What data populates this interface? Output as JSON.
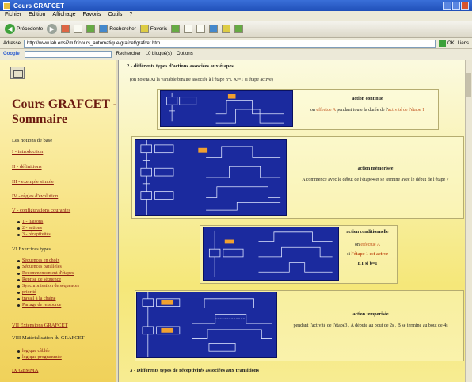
{
  "window": {
    "title": "Cours GRAFCET"
  },
  "menu": [
    "Fichier",
    "Edition",
    "Affichage",
    "Favoris",
    "Outils",
    "?"
  ],
  "toolbar": {
    "back": "Précédente",
    "search": "Rechercher",
    "favorites": "Favoris"
  },
  "address": {
    "label": "Adresse",
    "url": "http://www.lab.ensi2m.fr/cours_automatique/grafcet/grafcet.htm",
    "go": "OK",
    "links": "Liens"
  },
  "googlebar": {
    "logo": "Google",
    "search": "Rechercher",
    "blocked": "10 bloqué(s)",
    "options": "Options"
  },
  "sidebar": {
    "title": "Cours GRAFCET - Sommaire",
    "intro_text": "Les notions de base",
    "basics": [
      "I - introduction",
      "II - définitions",
      "III - exemple simple",
      "IV - règles d'évolution",
      "V - configurations courantes"
    ],
    "config_sub": [
      "1 - liaisons",
      "2 - actions",
      "3 - réceptivités"
    ],
    "exercises_heading": "VI Exercices types",
    "exercises": [
      "Séquences en choix",
      "Séquences parallèles",
      "Recommencement d'étapes",
      "Reprise de séquence",
      "Synchronisation de séquences",
      "priorité",
      "travail à la chaîne",
      "Partage de ressource"
    ],
    "section_vii": "VII Extensions GRAFCET",
    "section_viii": "VIII Matérialisation du GRAFCET",
    "materialization": [
      "logique câblée",
      "logique programmée"
    ],
    "section_ix": "IX GEMMA"
  },
  "main": {
    "section_title": "2 - différents types d'actions associées aux étapes",
    "note": "(on notera Xi la variable binaire associée à l'étape n°i. Xi=1 si étape active)",
    "actions": [
      {
        "heading": "action continue",
        "line_pre": "on",
        "line_hl": "effectue A",
        "line_mid": "pendant toute la durée de l'",
        "line_hl2": "activité de l'étape 1"
      },
      {
        "heading": "action mémorisée",
        "line": "A commence avec le début de l'étape4 et se termine avec le début de l'étape 7"
      },
      {
        "heading": "action conditionnelle",
        "line1_pre": "on",
        "line1_hl": "effectue A",
        "line2_pre": "si",
        "line2_hl": "l'étape 1 est active",
        "line3": "ET si b=1"
      },
      {
        "heading": "action temporisée",
        "line": "pendant l'activité de l'étape3 , A débute au bout de 2s , B se termine au bout de 4s"
      }
    ],
    "bottom_title": "3 - Différents types de réceptivités associées aux transitions"
  },
  "colors": {
    "diagram_bg": "#1b2a9e",
    "highlight": "#c0501a",
    "sidebar_title": "#6b1a10"
  }
}
